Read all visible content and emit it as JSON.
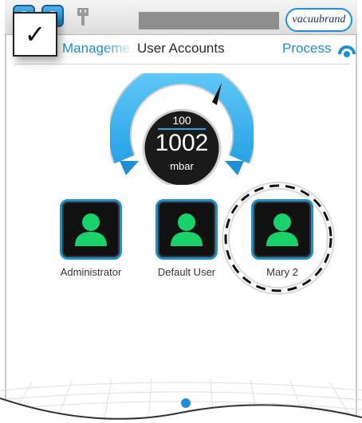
{
  "header": {
    "brand": "vacuubrand",
    "nav_left": "Manageme",
    "title": "User Accounts",
    "nav_right": "Process"
  },
  "overlay": {
    "check": "✓"
  },
  "gauge": {
    "setpoint": "100",
    "pressure": "1002",
    "unit": "mbar",
    "accent": "#3ab4ef"
  },
  "users": [
    {
      "name": "Administrator"
    },
    {
      "name": "Default User"
    },
    {
      "name": "Mary 2"
    }
  ],
  "colors": {
    "accent": "#1e8fd4",
    "user_icon": "#19d36a",
    "tile": "#111111"
  },
  "icons": [
    "plug-icon",
    "process-icon",
    "user-icon",
    "page-indicator-dot"
  ]
}
